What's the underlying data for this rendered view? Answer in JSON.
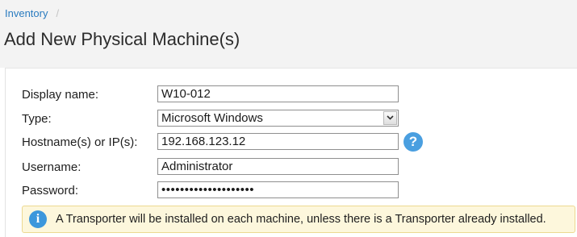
{
  "breadcrumb": {
    "items": [
      {
        "label": "Inventory"
      }
    ],
    "separator": "/"
  },
  "page": {
    "title": "Add New Physical Machine(s)"
  },
  "form": {
    "display_name": {
      "label": "Display name:",
      "value": "W10-012"
    },
    "type": {
      "label": "Type:",
      "value": "Microsoft Windows"
    },
    "hostname": {
      "label": "Hostname(s) or IP(s):",
      "value": "192.168.123.12"
    },
    "username": {
      "label": "Username:",
      "value": "Administrator"
    },
    "password": {
      "label": "Password:",
      "value": "••••••••••••••••••••"
    }
  },
  "help": {
    "icon": "question-icon",
    "glyph": "?"
  },
  "notice": {
    "icon": "info-icon",
    "glyph": "i",
    "text": "A Transporter will be installed on each machine, unless there is a Transporter already installed."
  },
  "colors": {
    "link": "#2a7bbf",
    "header_background": "#f3f3f3",
    "help_icon": "#4a9fe0",
    "notice_background": "#fdf7dc",
    "notice_border": "#ecd990",
    "info_icon": "#3c97dc"
  }
}
